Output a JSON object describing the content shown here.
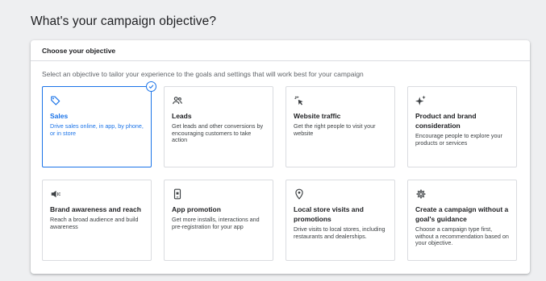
{
  "page": {
    "title": "What's your campaign objective?"
  },
  "panel": {
    "header": "Choose your objective",
    "description": "Select an objective to tailor your experience to the goals and settings that will work best for your campaign"
  },
  "accent_color": "#1a73e8",
  "objectives": [
    {
      "icon": "tag-icon",
      "title": "Sales",
      "description": "Drive sales online, in app, by phone, or in store",
      "selected": true
    },
    {
      "icon": "people-icon",
      "title": "Leads",
      "description": "Get leads and other conversions by encouraging customers to take action",
      "selected": false
    },
    {
      "icon": "cursor-click-icon",
      "title": "Website traffic",
      "description": "Get the right people to visit your website",
      "selected": false
    },
    {
      "icon": "sparkle-icon",
      "title": "Product and brand consideration",
      "description": "Encourage people to explore your products or services",
      "selected": false
    },
    {
      "icon": "speaker-icon",
      "title": "Brand awareness and reach",
      "description": "Reach a broad audience and build awareness",
      "selected": false
    },
    {
      "icon": "phone-icon",
      "title": "App promotion",
      "description": "Get more installs, interactions and pre-registration for your app",
      "selected": false
    },
    {
      "icon": "location-pin-icon",
      "title": "Local store visits and promotions",
      "description": "Drive visits to local stores, including restaurants and dealerships.",
      "selected": false
    },
    {
      "icon": "gear-icon",
      "title": "Create a campaign without a goal's guidance",
      "description": "Choose a campaign type first, without a recommendation based on your objective.",
      "selected": false
    }
  ]
}
